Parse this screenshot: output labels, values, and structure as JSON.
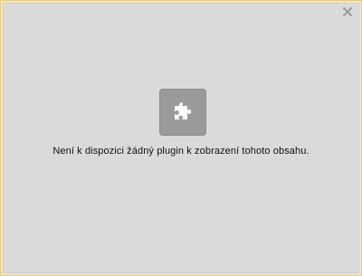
{
  "plugin": {
    "message": "Není k dispozici žádný plugin k zobrazení tohoto obsahu.",
    "icon": "puzzle-piece-icon",
    "close_icon": "close-icon"
  },
  "colors": {
    "background": "#dadada",
    "tile": "#9a9a9a",
    "frame": "#f3e6bf"
  }
}
